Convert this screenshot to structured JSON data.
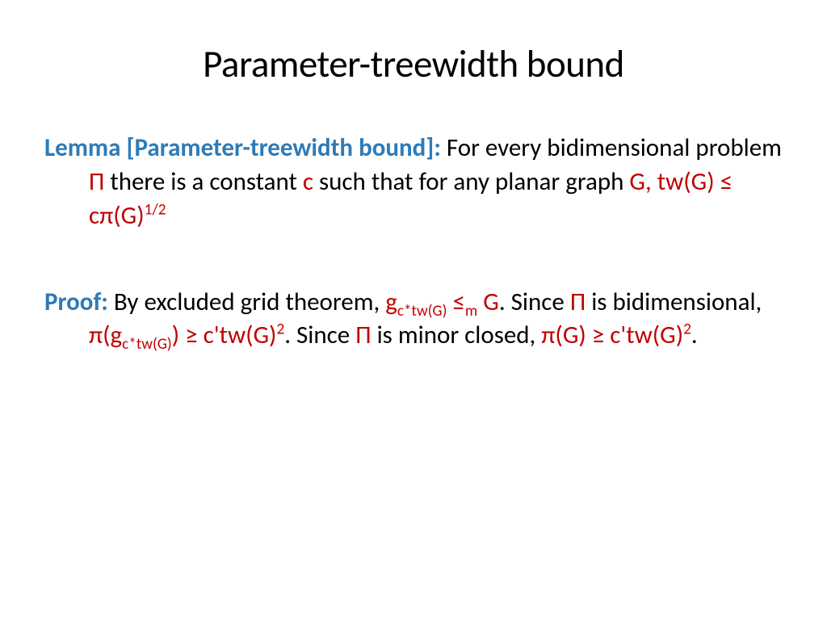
{
  "title": "Parameter-treewidth bound",
  "lemma": {
    "label": "Lemma [Parameter-treewidth bound]:",
    "text1": " For every bidimensional problem ",
    "pi1": "Π",
    "text2": " there is a constant ",
    "c": "c",
    "text3": " such that for any planar graph ",
    "inequality": "G, tw(G) ≤ cπ(G)",
    "exp": "1/2"
  },
  "proof": {
    "label": "Proof:",
    "text1": " By excluded grid theorem, ",
    "g1": "g",
    "sub1": "c*tw(G)",
    "leq": " ≤",
    "subm": "m",
    "sp": " ",
    "G1": "G",
    "text2": ". Since ",
    "pi2": "Π",
    "text3": " is bidimensional, ",
    "pig": "π(g",
    "sub2": "c*tw(G)",
    "close1": ") ≥ c'tw(G)",
    "exp2": "2",
    "text4": ". Since ",
    "pi3": "Π",
    "text5": " is minor closed, ",
    "piG": "π(G) ≥ c'tw(G)",
    "exp3": "2",
    "period": "."
  }
}
